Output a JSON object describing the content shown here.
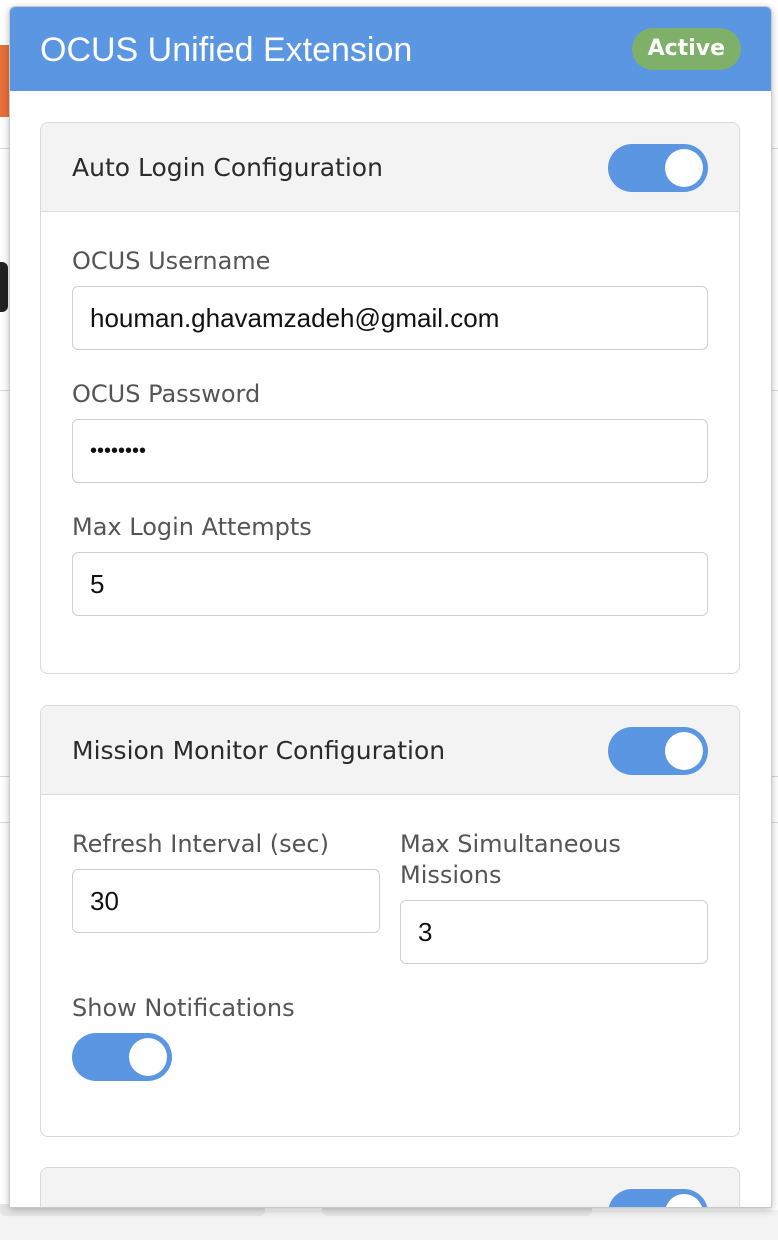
{
  "header": {
    "title": "OCUS Unified Extension",
    "status_badge": "Active"
  },
  "auto_login": {
    "title": "Auto Login Configuration",
    "enabled": true,
    "username_label": "OCUS Username",
    "username_value": "houman.ghavamzadeh@gmail.com",
    "password_label": "OCUS Password",
    "password_masked": "••••••••",
    "max_attempts_label": "Max Login Attempts",
    "max_attempts_value": "5"
  },
  "mission_monitor": {
    "title": "Mission Monitor Configuration",
    "enabled": true,
    "refresh_label": "Refresh Interval (sec)",
    "refresh_value": "30",
    "max_missions_label_line1": "Max Simultaneous",
    "max_missions_label_line2": "Missions",
    "max_missions_value": "3",
    "notifications_label": "Show Notifications",
    "notifications_enabled": true
  },
  "mission_acceptor": {
    "enabled": true
  },
  "colors": {
    "header_blue": "#5b96e3",
    "badge_green": "#7fb06a",
    "toggle_on": "#5b96e3"
  }
}
